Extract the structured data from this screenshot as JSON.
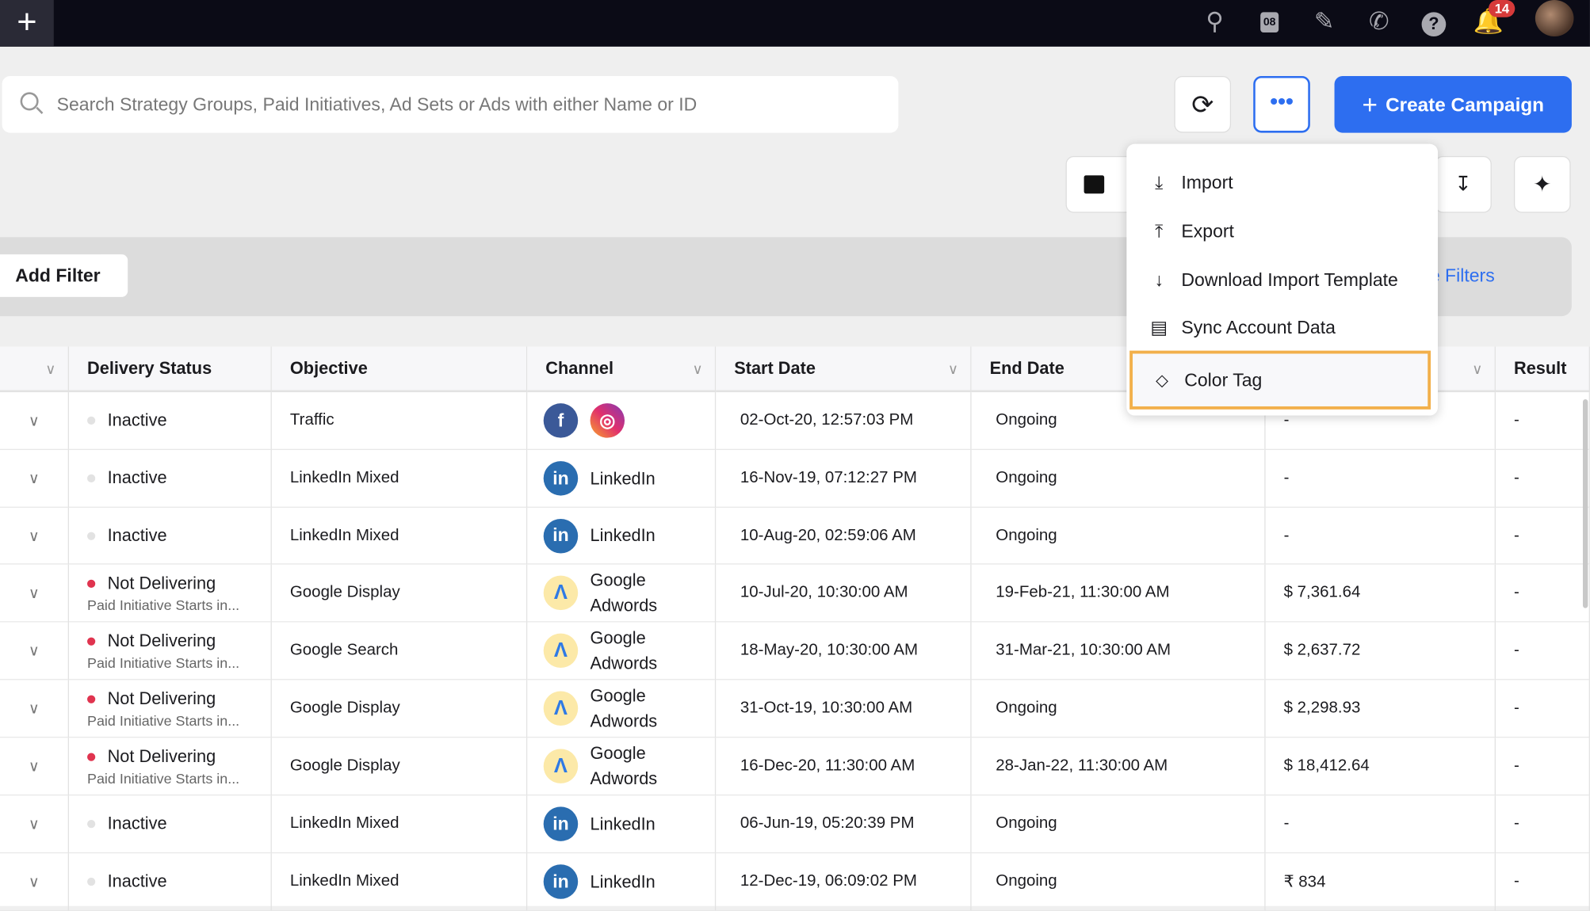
{
  "topbar": {
    "notification_count": "14",
    "icons": [
      "plus-icon",
      "search-icon",
      "calendar-icon",
      "pencil-icon",
      "phone-icon",
      "help-icon",
      "bell-icon"
    ],
    "calendar_day": "08"
  },
  "search": {
    "placeholder": "Search Strategy Groups, Paid Initiatives, Ad Sets or Ads with either Name or ID"
  },
  "toolbar": {
    "create_label": "Create Campaign",
    "more_label": "•••"
  },
  "filters": {
    "add_label": "Add Filter",
    "manage_label": "nage Filters"
  },
  "menu": {
    "items": [
      {
        "label": "Import",
        "icon": "import-icon"
      },
      {
        "label": "Export",
        "icon": "export-icon"
      },
      {
        "label": "Download Import Template",
        "icon": "download-template-icon"
      },
      {
        "label": "Sync Account Data",
        "icon": "sync-account-icon"
      },
      {
        "label": "Color Tag",
        "icon": "tag-icon",
        "highlighted": true
      }
    ]
  },
  "table": {
    "headers": [
      "",
      "Delivery Status",
      "Objective",
      "Channel",
      "Start Date",
      "End Date",
      "",
      "Result"
    ],
    "rows": [
      {
        "status": "Inactive",
        "sub": "",
        "objective": "Traffic",
        "channel": "facebook+instagram",
        "channel_label": "",
        "start": "02-Oct-20, 12:57:03 PM",
        "end": "Ongoing",
        "amount": "-",
        "result": "-"
      },
      {
        "status": "Inactive",
        "sub": "",
        "objective": "LinkedIn Mixed",
        "channel": "linkedin",
        "channel_label": "LinkedIn",
        "start": "16-Nov-19, 07:12:27 PM",
        "end": "Ongoing",
        "amount": "-",
        "result": "-"
      },
      {
        "status": "Inactive",
        "sub": "",
        "objective": "LinkedIn Mixed",
        "channel": "linkedin",
        "channel_label": "LinkedIn",
        "start": "10-Aug-20, 02:59:06 AM",
        "end": "Ongoing",
        "amount": "-",
        "result": "-"
      },
      {
        "status": "Not Delivering",
        "sub": "Paid Initiative Starts in...",
        "objective": "Google Display",
        "channel": "adwords",
        "channel_label": "Google Adwords",
        "start": "10-Jul-20, 10:30:00 AM",
        "end": "19-Feb-21, 11:30:00 AM",
        "amount": "$ 7,361.64",
        "result": "-"
      },
      {
        "status": "Not Delivering",
        "sub": "Paid Initiative Starts in...",
        "objective": "Google Search",
        "channel": "adwords",
        "channel_label": "Google Adwords",
        "start": "18-May-20, 10:30:00 AM",
        "end": "31-Mar-21, 10:30:00 AM",
        "amount": "$ 2,637.72",
        "result": "-"
      },
      {
        "status": "Not Delivering",
        "sub": "Paid Initiative Starts in...",
        "objective": "Google Display",
        "channel": "adwords",
        "channel_label": "Google Adwords",
        "start": "31-Oct-19, 10:30:00 AM",
        "end": "Ongoing",
        "amount": "$ 2,298.93",
        "result": "-"
      },
      {
        "status": "Not Delivering",
        "sub": "Paid Initiative Starts in...",
        "objective": "Google Display",
        "channel": "adwords",
        "channel_label": "Google Adwords",
        "start": "16-Dec-20, 11:30:00 AM",
        "end": "28-Jan-22, 11:30:00 AM",
        "amount": "$ 18,412.64",
        "result": "-"
      },
      {
        "status": "Inactive",
        "sub": "",
        "objective": "LinkedIn Mixed",
        "channel": "linkedin",
        "channel_label": "LinkedIn",
        "start": "06-Jun-19, 05:20:39 PM",
        "end": "Ongoing",
        "amount": "-",
        "result": "-"
      },
      {
        "status": "Inactive",
        "sub": "",
        "objective": "LinkedIn Mixed",
        "channel": "linkedin",
        "channel_label": "LinkedIn",
        "start": "12-Dec-19, 06:09:02 PM",
        "end": "Ongoing",
        "amount": "₹ 834",
        "result": "-"
      }
    ]
  },
  "colors": {
    "accent": "#2d6ef0",
    "highlight": "#f2b04b",
    "not_delivering": "#e0344f",
    "inactive": "#e2e2e2"
  }
}
